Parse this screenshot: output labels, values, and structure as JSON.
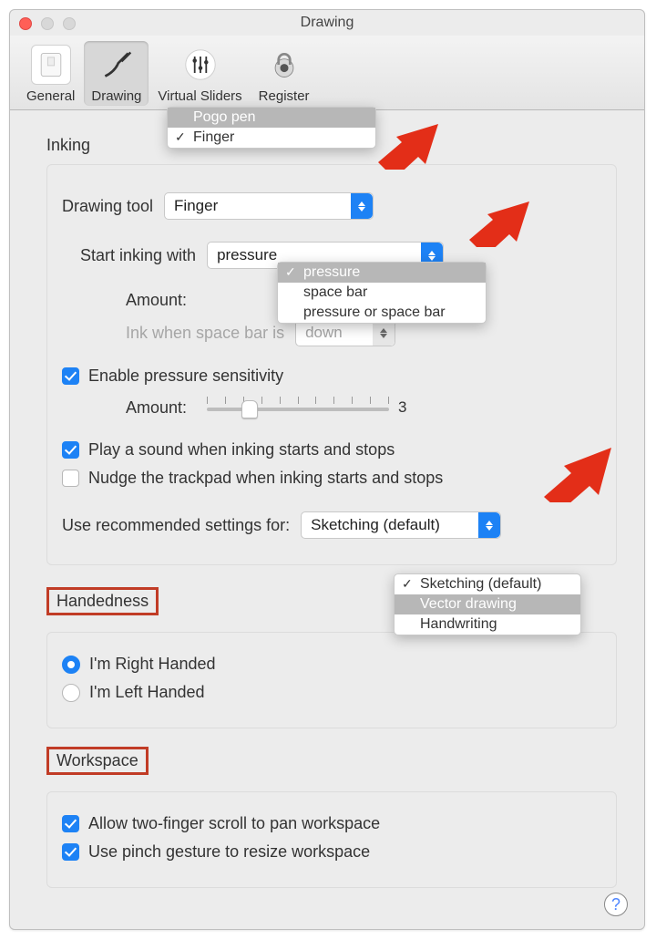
{
  "window": {
    "title": "Drawing"
  },
  "toolbar": {
    "general": "General",
    "drawing": "Drawing",
    "sliders": "Virtual Sliders",
    "register": "Register"
  },
  "inking": {
    "heading": "Inking",
    "drawing_tool_label": "Drawing tool",
    "drawing_tool_value": "Finger",
    "drawing_tool_options": [
      "Pogo pen",
      "Finger"
    ],
    "drawing_tool_selected_index": 1,
    "start_ink_label": "Start inking with",
    "start_ink_value": "pressure",
    "start_ink_options": [
      "pressure",
      "space bar",
      "pressure or space bar"
    ],
    "start_ink_selected_index": 0,
    "amount1_label": "Amount:",
    "spacebar_label": "Ink when space bar is",
    "spacebar_value": "down",
    "enable_pressure_label": "Enable pressure sensitivity",
    "amount2_label": "Amount:",
    "amount2_value": "3",
    "play_sound_label": "Play a sound when inking starts and stops",
    "nudge_label": "Nudge the trackpad when inking starts and stops",
    "recommend_label": "Use recommended settings for:",
    "recommend_value": "Sketching (default)",
    "recommend_options": [
      "Sketching (default)",
      "Vector drawing",
      "Handwriting"
    ],
    "recommend_selected_index": 0
  },
  "handedness": {
    "heading": "Handedness",
    "right": "I'm Right Handed",
    "left": "I'm Left Handed"
  },
  "workspace": {
    "heading": "Workspace",
    "scroll": "Allow two-finger scroll to pan workspace",
    "pinch": "Use pinch gesture to resize workspace"
  },
  "help": "?",
  "colors": {
    "accent": "#1d82f5",
    "annotation": "#c13c26"
  }
}
